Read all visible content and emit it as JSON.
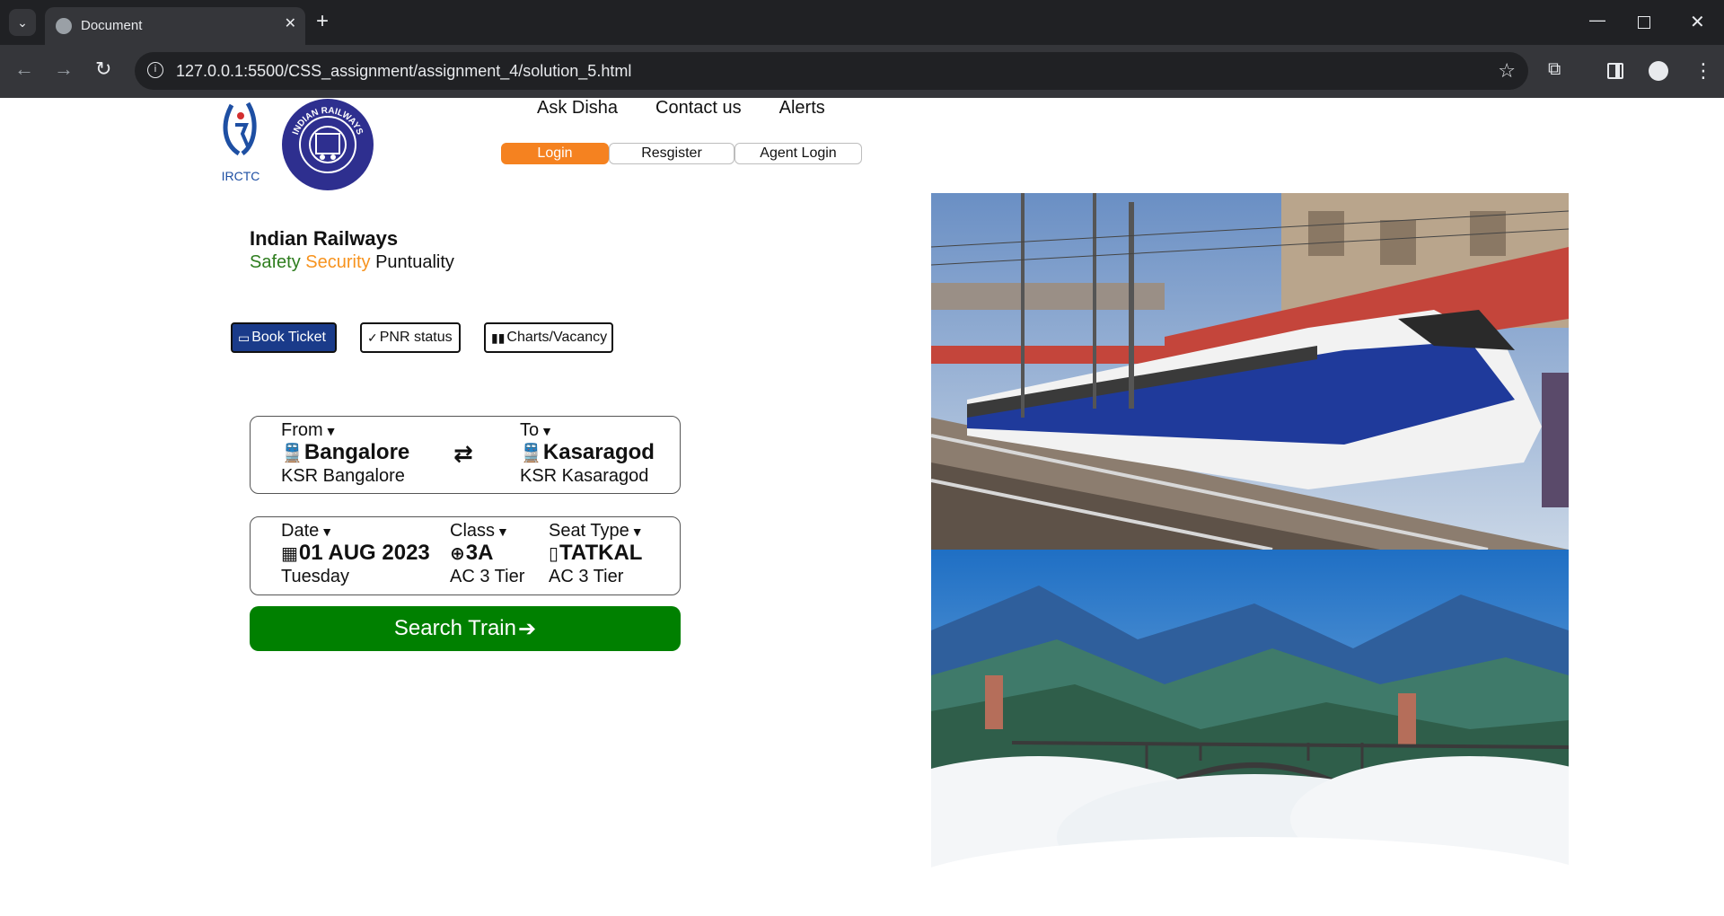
{
  "browser": {
    "tab_title": "Document",
    "url": "127.0.0.1:5500/CSS_assignment/assignment_4/solution_5.html",
    "icons": [
      "tab-search-icon",
      "globe-icon",
      "close-icon",
      "plus-icon",
      "minimize-icon",
      "maximize-icon",
      "window-close-icon",
      "back-icon",
      "forward-icon",
      "reload-icon",
      "info-icon",
      "star-icon",
      "extensions-icon",
      "side-panel-icon",
      "profile-icon",
      "kebab-menu-icon"
    ]
  },
  "header": {
    "logo_irctc_text": "IRCTC",
    "logo_ir_text": "INDIAN RAILWAYS",
    "nav": [
      "Ask Disha",
      "Contact us",
      "Alerts"
    ],
    "auth": {
      "login": "Login",
      "register": "Resgister",
      "agent_login": "Agent Login"
    }
  },
  "brand": {
    "title": "Indian Railways",
    "tag_safety": "Safety",
    "tag_security": "Security",
    "tag_punctuality": "Puntuality"
  },
  "modes": {
    "book_ticket": "Book Ticket",
    "pnr_status": "PNR status",
    "charts_vacancy": "Charts/Vacancy"
  },
  "journey": {
    "from_label": "From",
    "from_station": "Bangalore",
    "from_sub": "KSR Bangalore",
    "to_label": "To",
    "to_station": "Kasaragod",
    "to_sub": "KSR Kasaragod"
  },
  "booking": {
    "date_label": "Date",
    "date_value": "01 AUG 2023",
    "date_sub": "Tuesday",
    "class_label": "Class",
    "class_value": "3A",
    "class_sub": "AC 3 Tier",
    "seat_label": "Seat Type",
    "seat_value": "TATKAL",
    "seat_sub": "AC 3 Tier"
  },
  "search_button": "Search Train",
  "colors": {
    "login_orange": "#f58220",
    "safety_green": "#2e7d1e",
    "security_orange": "#f7931e",
    "book_ticket_blue": "#1a3b8a",
    "search_green": "#008000"
  }
}
